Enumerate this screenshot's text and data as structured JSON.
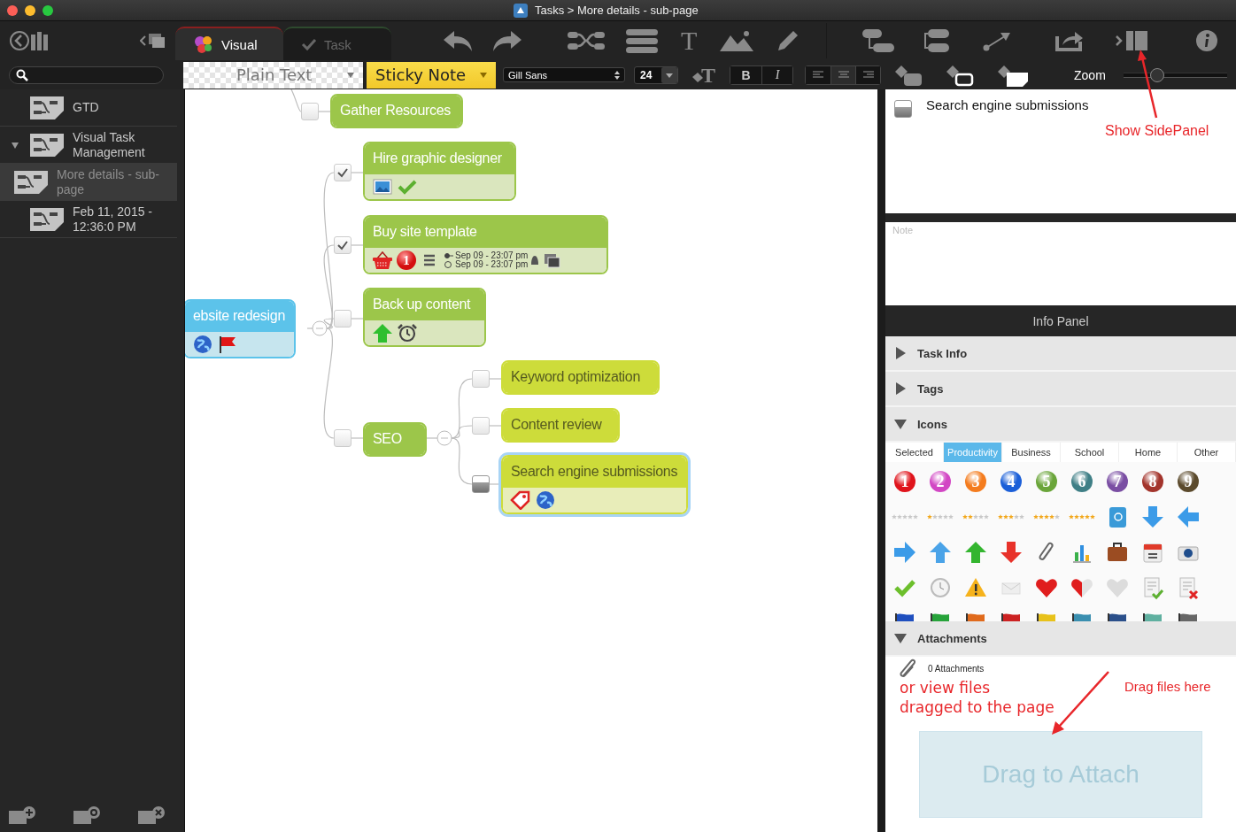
{
  "window": {
    "title": "Tasks > More details - sub-page"
  },
  "toolbar": {
    "tabs": [
      {
        "label": "Visual",
        "selected": true
      },
      {
        "label": "Task",
        "selected": false
      }
    ],
    "text_tool": "T",
    "text_style": "Plain Text",
    "note_style": "Sticky Note",
    "font": "Gill Sans",
    "font_size": "24",
    "text_color_tool": "T",
    "bold": "B",
    "italic": "I",
    "zoom_label": "Zoom",
    "zoom": {
      "level": 0.33
    }
  },
  "sidebar": {
    "items": [
      {
        "label": "GTD",
        "selected": false
      },
      {
        "label": "Visual Task Management",
        "selected": false,
        "expanded": true,
        "children": [
          {
            "label": "More details - sub-page",
            "selected": true
          }
        ]
      },
      {
        "label": "Feb 11, 2015 - 12:36:0 PM",
        "selected": false
      }
    ]
  },
  "mindmap": {
    "nodes": [
      {
        "title": "Gather Resources",
        "color": "#9cc64a",
        "checked": false,
        "selected": false
      },
      {
        "title": "ebsite redesign",
        "color": "#5cc3ea",
        "selected": false,
        "children": [
          {
            "title": "Hire graphic designer",
            "color": "#9cc64a",
            "checked": true,
            "selected": false
          },
          {
            "title": "Buy site template",
            "color": "#9cc64a",
            "checked": true,
            "selected": false,
            "priority": "1",
            "dates": [
              "Sep 09 - 23:07 pm",
              "Sep 09 - 23:07 pm"
            ]
          },
          {
            "title": "Back up content",
            "color": "#9cc64a",
            "checked": false,
            "selected": false
          },
          {
            "title": "SEO",
            "color": "#9cc64a",
            "checked": false,
            "selected": false,
            "children": [
              {
                "title": "Keyword optimization",
                "color": "#cddc3a",
                "checked": false,
                "selected": false
              },
              {
                "title": "Content review",
                "color": "#cddc3a",
                "checked": false,
                "selected": false
              },
              {
                "title": "Search engine submissions",
                "color": "#cddc3a",
                "kind": "in_progress",
                "selected": true
              }
            ]
          }
        ]
      }
    ]
  },
  "info_panel": {
    "task": {
      "title": "Search engine submissions",
      "kind": "in_progress"
    },
    "note": {
      "placeholder": "Note"
    },
    "label": "Info Panel",
    "sections": [
      {
        "kind": "task_info",
        "title": "Task Info",
        "expanded": false
      },
      {
        "kind": "tags",
        "title": "Tags",
        "expanded": false
      },
      {
        "kind": "icons",
        "title": "Icons",
        "expanded": true
      },
      {
        "kind": "attachments",
        "title": "Attachments",
        "expanded": true
      }
    ],
    "icon_tabs": [
      {
        "label": "Selected",
        "selected": false
      },
      {
        "label": "Productivity",
        "selected": true
      },
      {
        "label": "Business",
        "selected": false
      },
      {
        "label": "School",
        "selected": false
      },
      {
        "label": "Home",
        "selected": false
      },
      {
        "label": "Other",
        "selected": false
      }
    ],
    "number_icons": [
      "1",
      "2",
      "3",
      "4",
      "5",
      "6",
      "7",
      "8",
      "9"
    ],
    "attachments": {
      "count": "0 Attachments",
      "drop": "Drag to Attach"
    }
  },
  "annotations": [
    {
      "text": "Show SidePanel"
    },
    {
      "text": "Drag files here"
    },
    {
      "text": "or view files dragged to the page"
    }
  ]
}
